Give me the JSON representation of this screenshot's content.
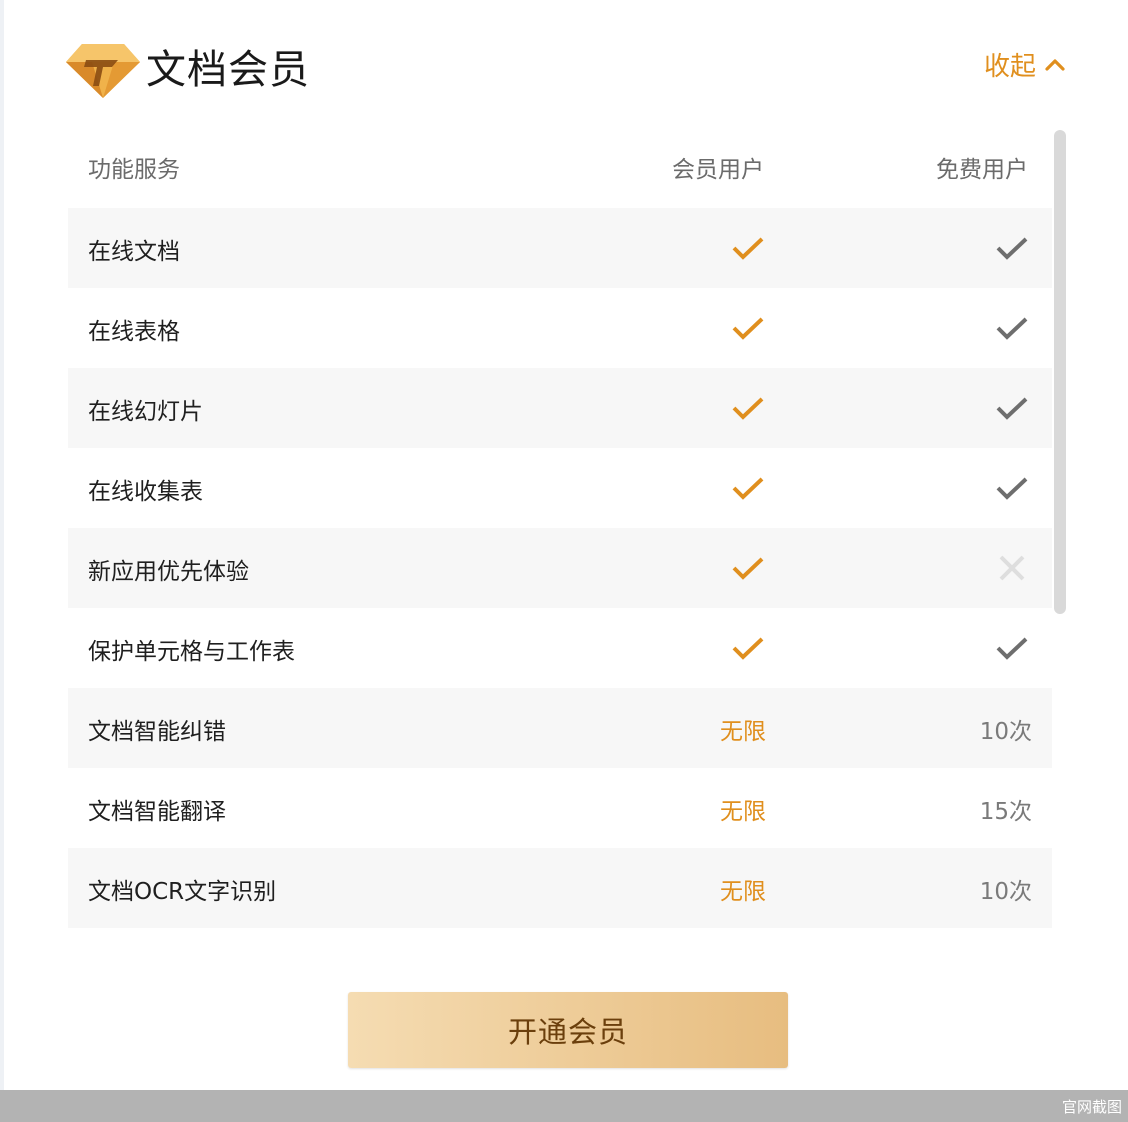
{
  "header": {
    "title": "文档会员",
    "collapse_label": "收起"
  },
  "table": {
    "headers": {
      "feature": "功能服务",
      "member": "会员用户",
      "free": "免费用户"
    },
    "rows": [
      {
        "feature": "在线文档",
        "member": "check",
        "free": "check"
      },
      {
        "feature": "在线表格",
        "member": "check",
        "free": "check"
      },
      {
        "feature": "在线幻灯片",
        "member": "check",
        "free": "check"
      },
      {
        "feature": "在线收集表",
        "member": "check",
        "free": "check"
      },
      {
        "feature": "新应用优先体验",
        "member": "check",
        "free": "cross"
      },
      {
        "feature": "保护单元格与工作表",
        "member": "check",
        "free": "check"
      },
      {
        "feature": "文档智能纠错",
        "member": "无限",
        "free": "10次"
      },
      {
        "feature": "文档智能翻译",
        "member": "无限",
        "free": "15次"
      },
      {
        "feature": "文档OCR文字识别",
        "member": "无限",
        "free": "10次"
      }
    ]
  },
  "cta": {
    "label": "开通会员"
  },
  "footer": {
    "label": "官网截图"
  },
  "colors": {
    "accent": "#e08f1e",
    "free_check": "#6e6e6e",
    "cross": "#dedede",
    "row_shade": "#f7f7f7"
  },
  "icons": {
    "logo": "diamond-logo-icon",
    "collapse": "chevron-up-icon",
    "member_check": "check-icon",
    "free_check": "check-icon",
    "unavailable": "close-icon"
  }
}
